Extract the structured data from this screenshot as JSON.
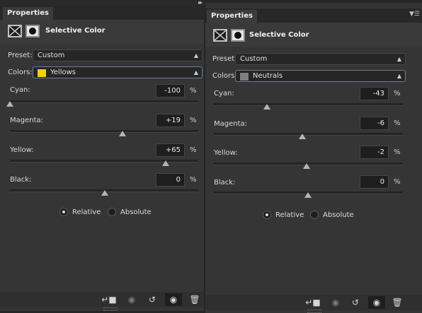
{
  "panels": [
    {
      "tab_label": "Properties",
      "title": "Selective Color",
      "preset_label": "Preset:",
      "preset_value": "Custom",
      "colors_label": "Colors:",
      "colors_value": "Yellows",
      "colors_swatch": "#f0d400",
      "sliders": [
        {
          "label": "Cyan:",
          "value": "-100",
          "unit": "%",
          "level": -100
        },
        {
          "label": "Magenta:",
          "value": "+19",
          "unit": "%",
          "level": 19
        },
        {
          "label": "Yellow:",
          "value": "+65",
          "unit": "%",
          "level": 65
        },
        {
          "label": "Black:",
          "value": "0",
          "unit": "%",
          "level": 0
        }
      ],
      "method": {
        "relative": "Relative",
        "absolute": "Absolute",
        "selected": "relative"
      }
    },
    {
      "tab_label": "Properties",
      "title": "Selective Color",
      "preset_label": "Preset:",
      "preset_value": "Custom",
      "colors_label": "Colors:",
      "colors_value": "Neutrals",
      "colors_swatch": "#808080",
      "sliders": [
        {
          "label": "Cyan:",
          "value": "-43",
          "unit": "%",
          "level": -43
        },
        {
          "label": "Magenta:",
          "value": "-6",
          "unit": "%",
          "level": -6
        },
        {
          "label": "Yellow:",
          "value": "-2",
          "unit": "%",
          "level": -2
        },
        {
          "label": "Black:",
          "value": "0",
          "unit": "%",
          "level": 0
        }
      ],
      "method": {
        "relative": "Relative",
        "absolute": "Absolute",
        "selected": "relative"
      }
    }
  ],
  "icons": {
    "collapse": "double-chevron-right-icon",
    "panel_menu": "panel-menu-icon",
    "footer": [
      "clip-to-layer-icon",
      "view-previous-state-icon",
      "reset-icon",
      "visibility-eye-icon",
      "trash-icon"
    ]
  }
}
